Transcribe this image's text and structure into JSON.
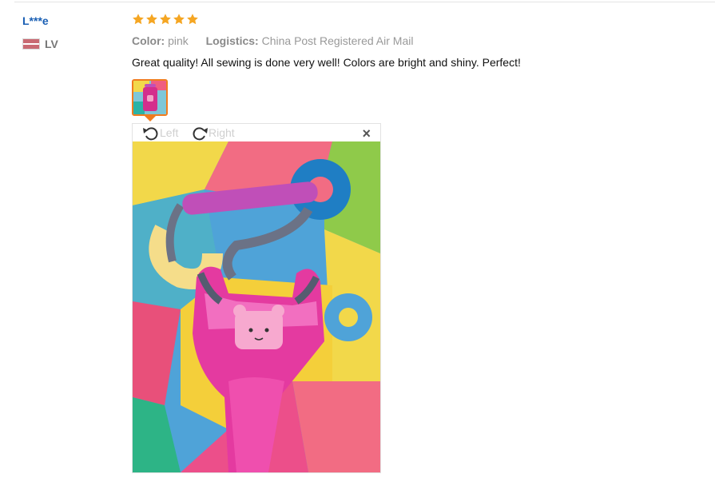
{
  "reviewer": {
    "name": "L***e",
    "country_code": "LV"
  },
  "review": {
    "rating": 5,
    "color_label": "Color:",
    "color_value": "pink",
    "logistics_label": "Logistics:",
    "logistics_value": "China Post Registered Air Mail",
    "text": "Great quality! All sewing is done very well! Colors are bright and shiny. Perfect!"
  },
  "viewer": {
    "rotate_left_label": "Left",
    "rotate_right_label": "Right",
    "close_label": "×"
  },
  "icons": {
    "star": "star-icon",
    "flag": "latvia-flag-icon",
    "rotate_left": "rotate-left-icon",
    "rotate_right": "rotate-right-icon",
    "close": "close-icon"
  },
  "colors": {
    "name": "#1a5fb4",
    "star": "#f5a623",
    "accent": "#f07c1e"
  }
}
